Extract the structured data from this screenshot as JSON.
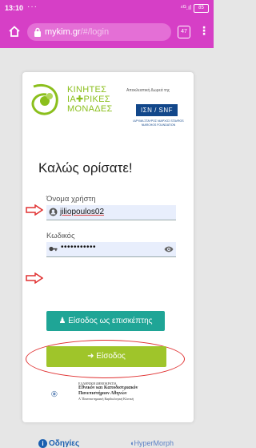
{
  "status_bar": {
    "time": "13:10",
    "dots": "···",
    "signal": "⁴ᴳ.ıl",
    "battery": "85"
  },
  "browser": {
    "url_host": "mykim.gr",
    "url_path": "/#/login",
    "tab_count": "47"
  },
  "header": {
    "logo_lines": [
      "ΚΙΝΗΤΕΣ",
      "ΙΑ✚ΡΙΚΕΣ",
      "ΜΟΝΑΔΕΣ"
    ],
    "donation": "Αποκλειστική Δωρεά της",
    "sponsor_badge": "ΙΣΝ / SNF",
    "sponsor_caption": "ΙΔΡΥΜΑ ΣΤΑΥΡΟΣ ΝΙΑΡΧΟΣ STAVROS NIARCHOS FOUNDATION"
  },
  "form": {
    "welcome": "Καλώς ορίσατε!",
    "username_label": "Όνομα χρήστη",
    "username_value": "jiliopoulos02",
    "password_label": "Κωδικός",
    "password_value": "•••••••••••",
    "guest_button": "Είσοδος ως επισκέπτης",
    "login_button": "Είσοδος"
  },
  "footer": {
    "uni_line1": "ΕΛΛΗΝΙΚΗ ΔΗΜΟΚΡΑΤΙΑ",
    "uni_line2": "Εθνικόν και Καποδιστριακόν",
    "uni_line3": "Πανεπιστήμιον Αθηνών",
    "uni_line4": "Α' Πανεπιστημιακή Καρδιολογική Κλινική",
    "guides": "Οδηγίες",
    "hypermorph": "HyperMorph"
  },
  "colors": {
    "brand": "#d63fc6",
    "teal": "#1fa596",
    "green": "#9fc52a",
    "annotation": "#e03030"
  }
}
